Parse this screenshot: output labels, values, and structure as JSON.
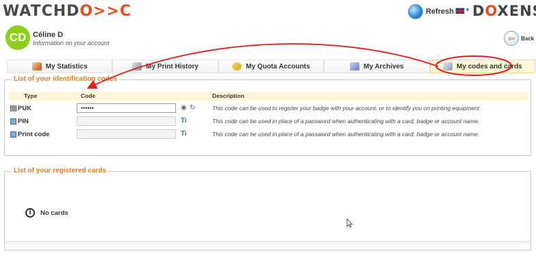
{
  "header": {
    "logo_prefix": "WATCHD",
    "logo_mark": "O>>C",
    "refresh_label": "Refresh",
    "brand_prefix": "D",
    "brand_mark": "O",
    "brand_suffix": "XENSE"
  },
  "user": {
    "initials": "CD",
    "name": "Céline D",
    "subtitle": "Information on your account",
    "back_label": "Back"
  },
  "tabs": [
    {
      "label": "My Statistics",
      "icon": "statistics-icon"
    },
    {
      "label": "My Print History",
      "icon": "print-history-icon"
    },
    {
      "label": "My Quota Accounts",
      "icon": "quota-icon"
    },
    {
      "label": "My Archives",
      "icon": "archives-icon"
    },
    {
      "label": "My codes and cards",
      "icon": "codes-cards-icon",
      "active": true
    }
  ],
  "codes": {
    "legend": "List of your identification codes",
    "columns": {
      "type": "Type",
      "code": "Code",
      "description": "Description"
    },
    "rows": [
      {
        "type": "PUK",
        "code": "••••••",
        "description": "This code can be used to register your badge with your account, or to identify you on printing equipment"
      },
      {
        "type": "PIN",
        "code": "",
        "description": "This code can be used in place of a password when authenticating with a card, badge or account name."
      },
      {
        "type": "Print code",
        "code": "",
        "description": "This code can be used in place of a password when authenticating with a card, badge or account name."
      }
    ]
  },
  "cards": {
    "legend": "List of your registered cards",
    "empty_label": "No cards"
  },
  "colors": {
    "accent_orange": "#e27a16",
    "avatar_green": "#8ccf1e",
    "annotation_red": "#e02020",
    "active_tab": "#fff7d9"
  }
}
